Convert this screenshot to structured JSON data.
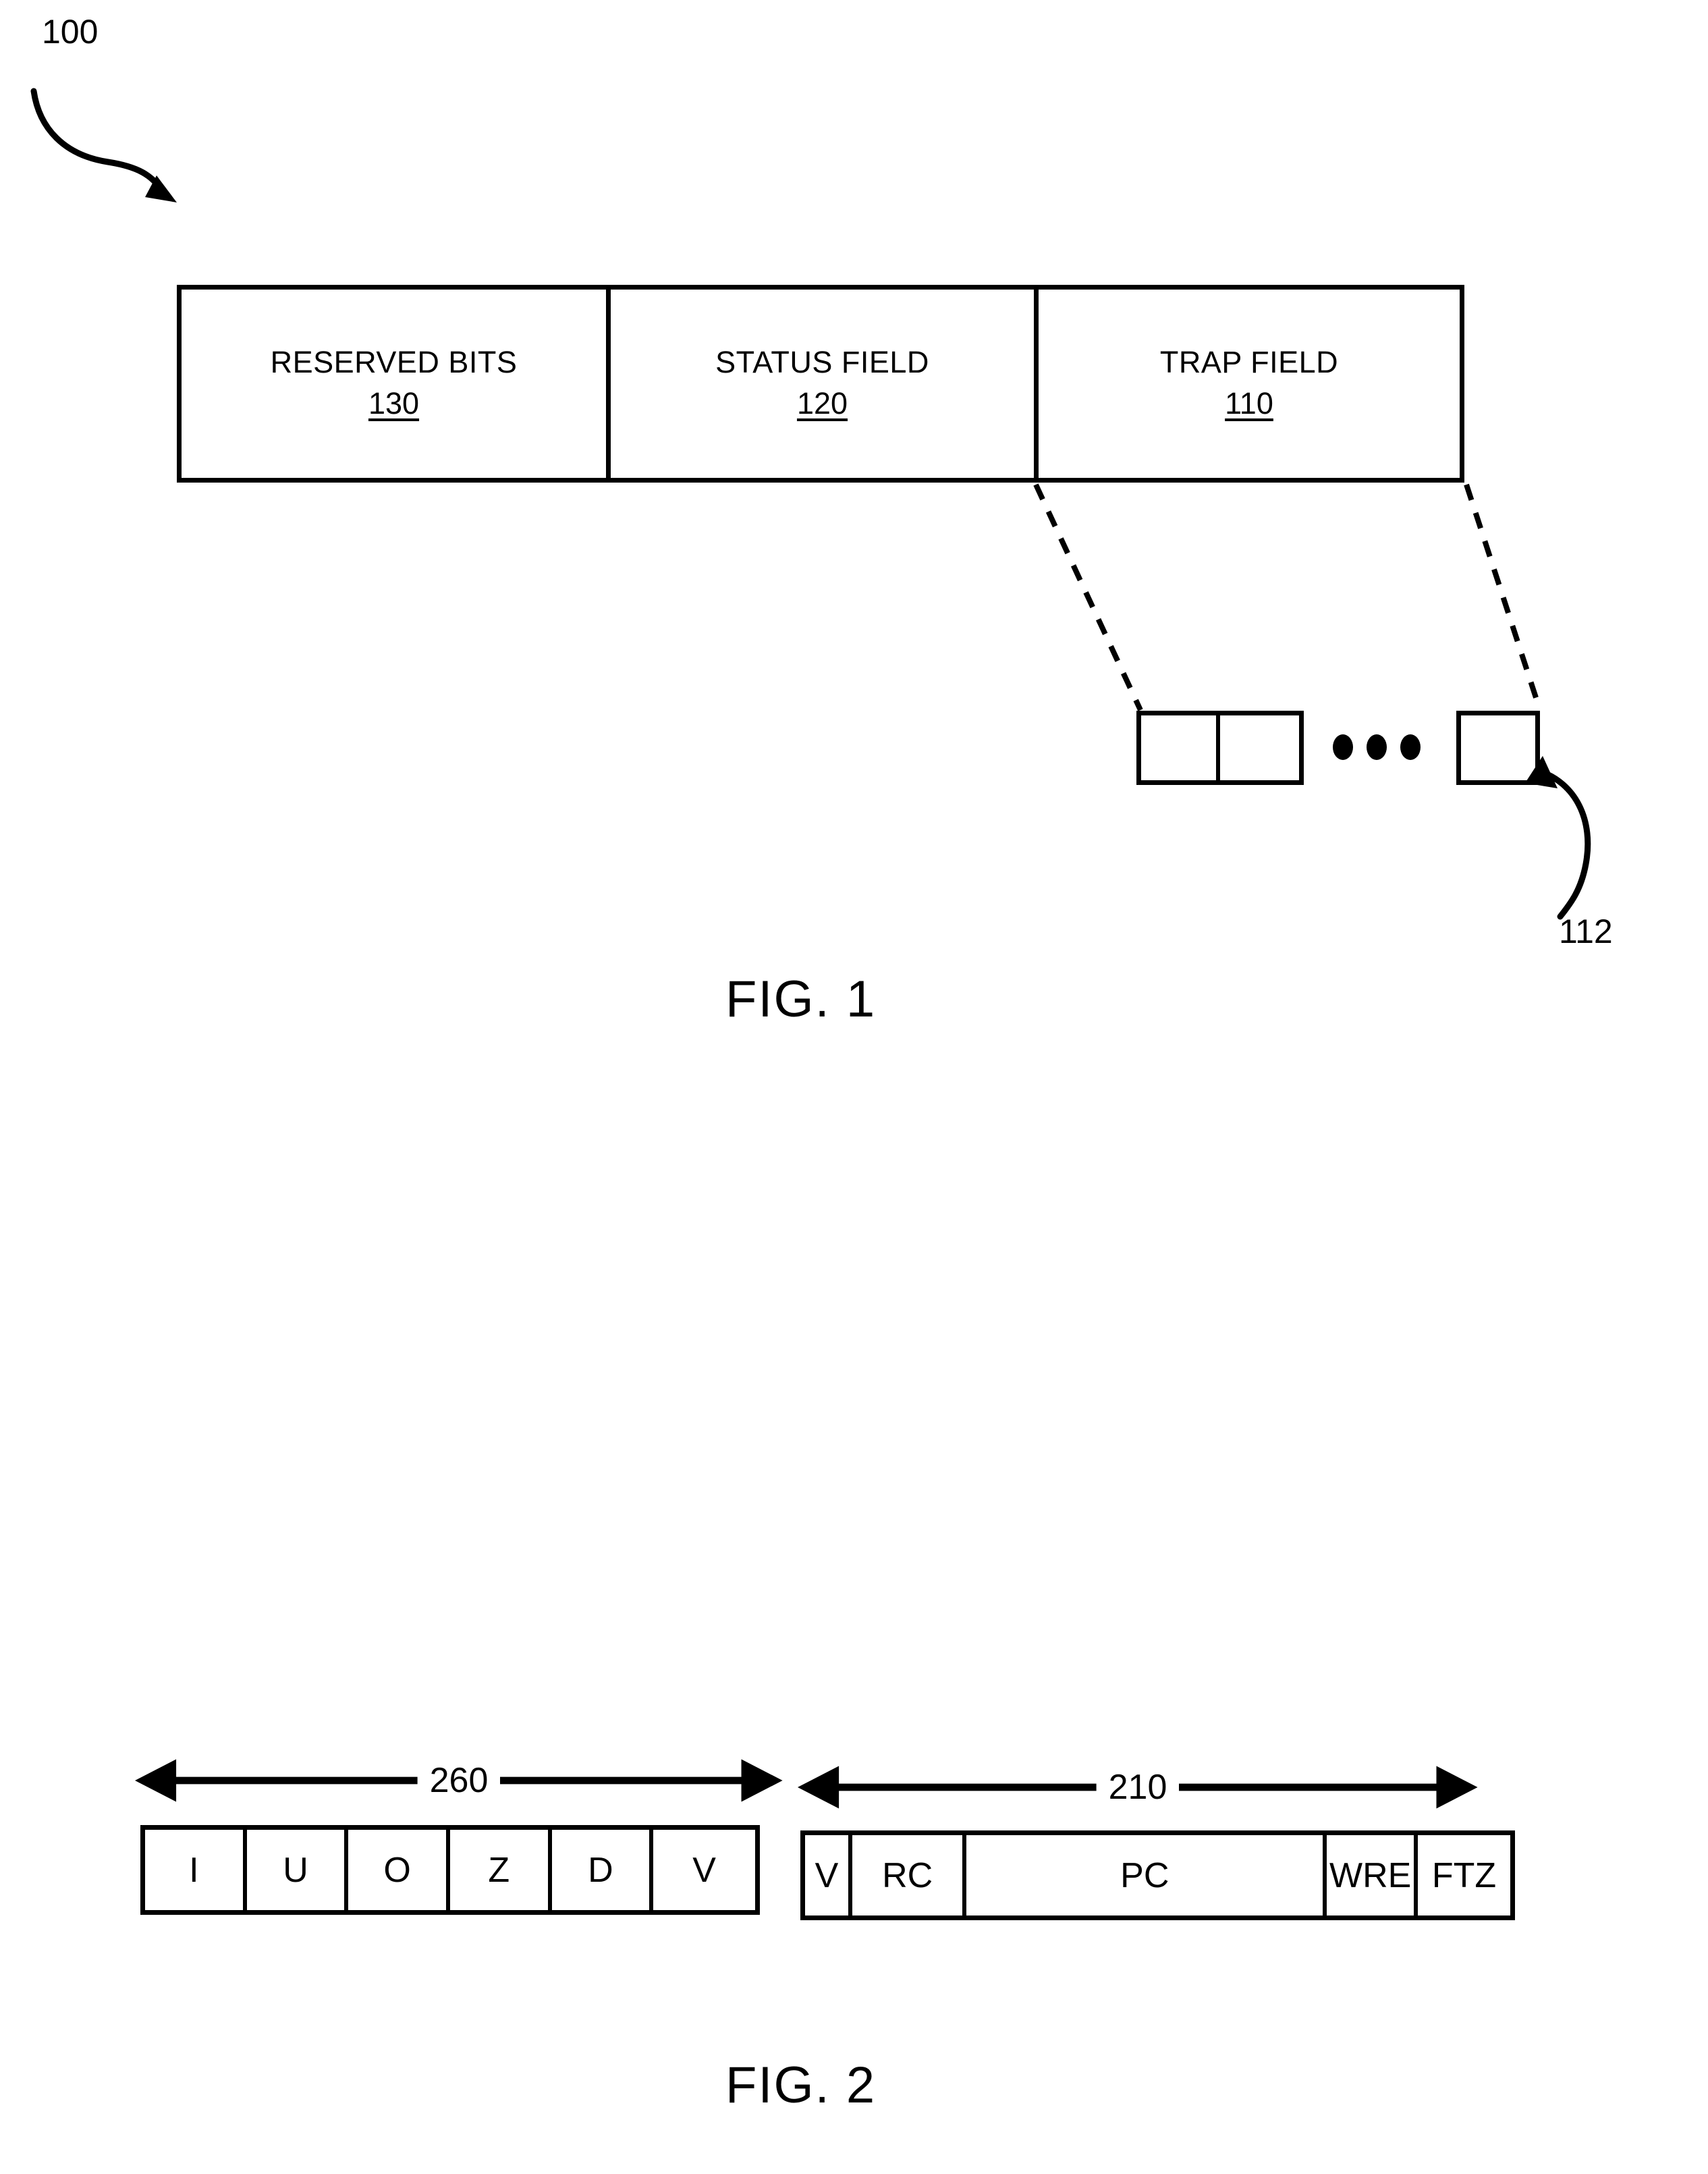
{
  "figure1": {
    "ref_number": "100",
    "detail_ref_number": "112",
    "caption": "FIG. 1",
    "register_cells": [
      {
        "title": "RESERVED BITS",
        "ref": "130"
      },
      {
        "title": "STATUS FIELD",
        "ref": "120"
      },
      {
        "title": "TRAP FIELD",
        "ref": "110"
      }
    ],
    "exploded": {
      "first_pair": [
        "",
        ""
      ],
      "ellipsis": "• • •",
      "last_box": ""
    }
  },
  "figure2": {
    "caption": "FIG. 2",
    "registers": [
      {
        "dimension_label": "260",
        "cells": [
          {
            "label": "I"
          },
          {
            "label": "U"
          },
          {
            "label": "O"
          },
          {
            "label": "Z"
          },
          {
            "label": "D"
          },
          {
            "label": "V"
          }
        ]
      },
      {
        "dimension_label": "210",
        "cells": [
          {
            "label": "V",
            "width_pct": 6.7
          },
          {
            "label": "RC",
            "width_pct": 13.5
          },
          {
            "label": "PC",
            "width_pct": 13.5
          },
          {
            "label": "WRE",
            "width_pct": 6.8
          },
          {
            "label": "FTZ",
            "width_pct": 6.8
          }
        ]
      }
    ]
  },
  "colors": {
    "ink": "#000000",
    "paper": "#ffffff"
  }
}
